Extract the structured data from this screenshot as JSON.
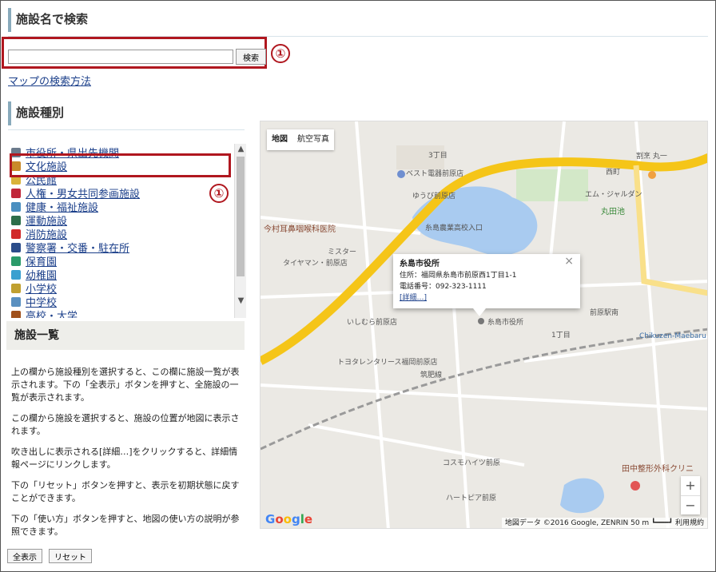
{
  "search_section": {
    "title": "施設名で検索",
    "input_value": "",
    "button_label": "検索",
    "badge": "①",
    "help_link": "マップの検索方法"
  },
  "category_section": {
    "title": "施設種別",
    "badge": "①",
    "items": [
      {
        "label": "市役所・県出先機関",
        "icon": "building-icon",
        "color": "#6b7b8c"
      },
      {
        "label": "文化施設",
        "icon": "culture-icon",
        "color": "#c98a2a"
      },
      {
        "label": "公民館",
        "icon": "hall-icon",
        "color": "#d9b23a"
      },
      {
        "label": "人権・男女共同参画施設",
        "icon": "heart-icon",
        "color": "#c0273a"
      },
      {
        "label": "健康・福祉施設",
        "icon": "health-icon",
        "color": "#4a8fc0"
      },
      {
        "label": "運動施設",
        "icon": "sports-icon",
        "color": "#2d6e4a"
      },
      {
        "label": "消防施設",
        "icon": "fire-icon",
        "color": "#d12a2a"
      },
      {
        "label": "警察署・交番・駐在所",
        "icon": "police-icon",
        "color": "#2b4c8a"
      },
      {
        "label": "保育園",
        "icon": "nursery-icon",
        "color": "#2a9a6a"
      },
      {
        "label": "幼稚園",
        "icon": "kindergarten-icon",
        "color": "#3aa0d0"
      },
      {
        "label": "小学校",
        "icon": "elementary-icon",
        "color": "#c0a030"
      },
      {
        "label": "中学校",
        "icon": "juniorhigh-icon",
        "color": "#5a90c0"
      },
      {
        "label": "高校・大学",
        "icon": "highschool-icon",
        "color": "#a0501a"
      }
    ]
  },
  "list_panel": {
    "title": "施設一覧",
    "help": [
      "上の欄から施設種別を選択すると、この欄に施設一覧が表示されます。下の「全表示」ボタンを押すと、全施設の一覧が表示されます。",
      "この欄から施設を選択すると、施設の位置が地図に表示されます。",
      "吹き出しに表示される[詳細…]をクリックすると、詳細情報ページにリンクします。",
      "下の「リセット」ボタンを押すと、表示を初期状態に戻すことができます。",
      "下の「使い方」ボタンを押すと、地図の使い方の説明が参照できます。"
    ],
    "show_all_button": "全表示",
    "reset_button": "リセット"
  },
  "map": {
    "type_map": "地図",
    "type_satellite": "航空写真",
    "info_window": {
      "title": "糸島市役所",
      "address": "住所：福岡県糸島市前原西1丁目1-1",
      "phone": "電話番号：092-323-1111",
      "more_link": "[詳細…]",
      "close": "×"
    },
    "labels": {
      "best": "ベスト電器前原店",
      "imamura": "今村耳鼻咽喉科医院",
      "misuta": "ミスター",
      "taiyaman": "タイヤマン・前原店",
      "maruta": "丸田池",
      "itoshima": "糸島市役所",
      "chikuhi": "筑肥線",
      "chikuzen": "Chikuzen-Maebaru",
      "tanaka": "田中整形外科クリニ",
      "heartpia": "ハートピア前原",
      "cosmo": "コスモハイツ前原",
      "nishi": "西町",
      "maebaru_station": "前原駅南",
      "shiokaze": "割烹 丸一",
      "toyota": "トヨタレンタリース福岡前原店",
      "jusco": "いしむら前原店",
      "ecchi": "エム・ジャルダン",
      "kogyo": "糸島農業高校入口",
      "chome3": "3丁目",
      "chome1": "1丁目",
      "yoshimura": "ゆうび前原店"
    },
    "zoom_in": "+",
    "zoom_out": "−",
    "google": "Google",
    "attribution": "地図データ ©2016 Google, ZENRIN   50 m ┗━━━┛   利用規約"
  }
}
